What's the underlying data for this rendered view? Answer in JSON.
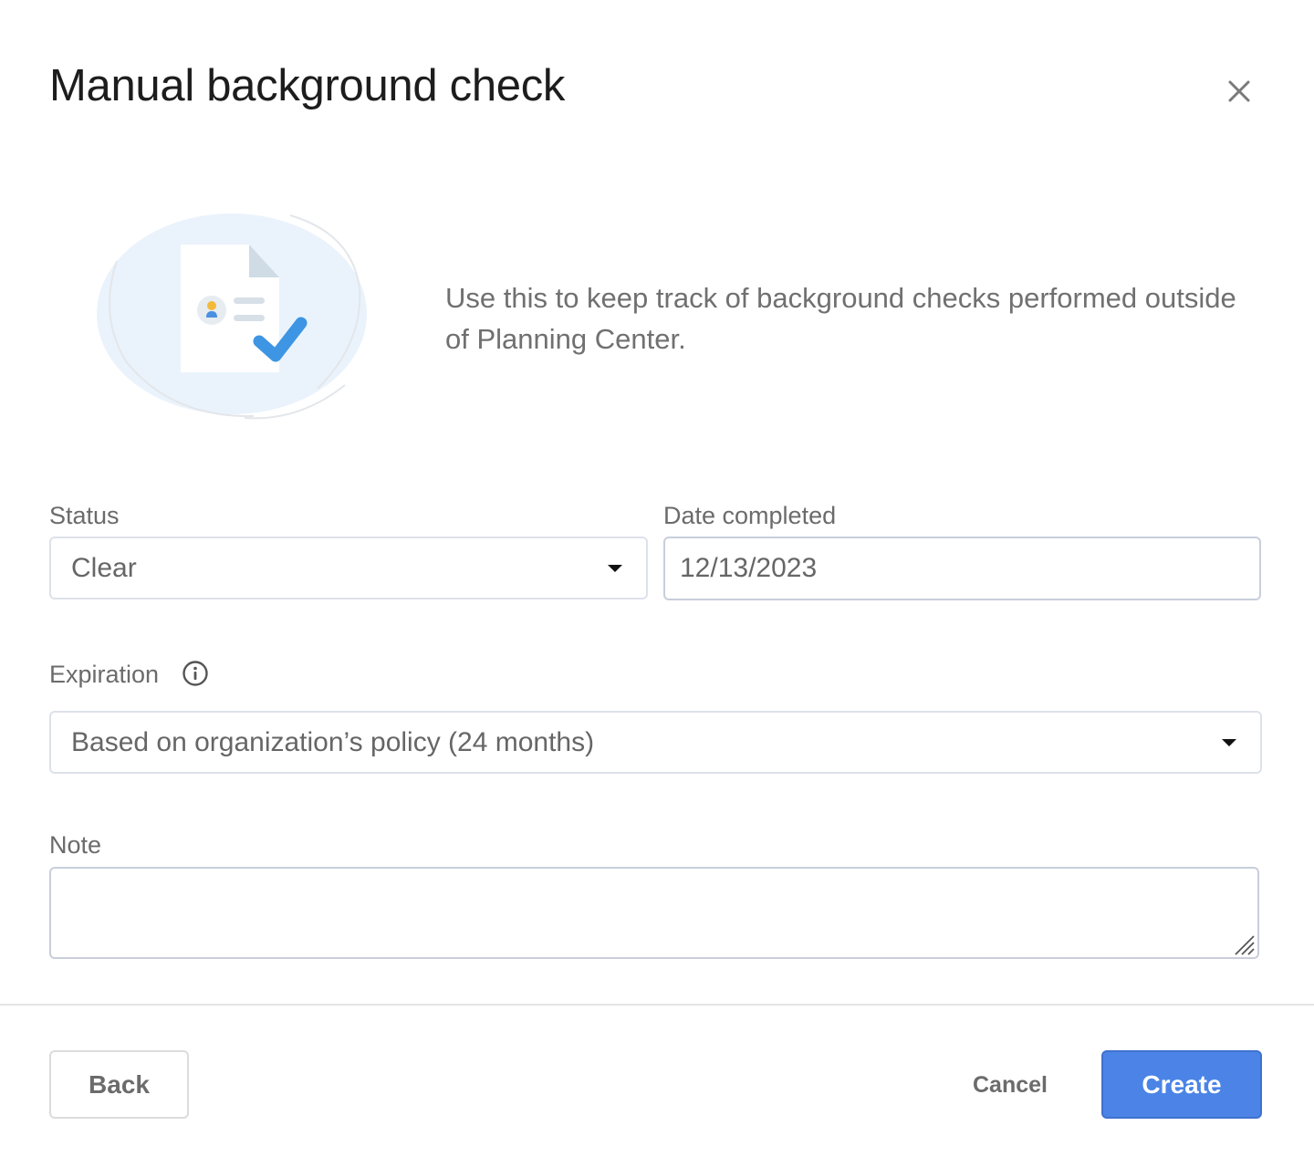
{
  "dialog": {
    "title": "Manual background check",
    "close_icon": "close-icon",
    "intro": "Use this to keep track of background checks performed outside of Planning Center.",
    "illustration_icon": "document-check-icon"
  },
  "form": {
    "status": {
      "label": "Status",
      "value": "Clear"
    },
    "date_completed": {
      "label": "Date completed",
      "value": "12/13/2023"
    },
    "expiration": {
      "label": "Expiration",
      "info_icon": "info-icon",
      "value": "Based on organization’s policy (24 months)"
    },
    "note": {
      "label": "Note",
      "value": ""
    }
  },
  "footer": {
    "back_label": "Back",
    "cancel_label": "Cancel",
    "create_label": "Create"
  },
  "colors": {
    "primary": "#4b84e6",
    "illustration_blob": "#eaf3fc",
    "check": "#3d95e3"
  }
}
